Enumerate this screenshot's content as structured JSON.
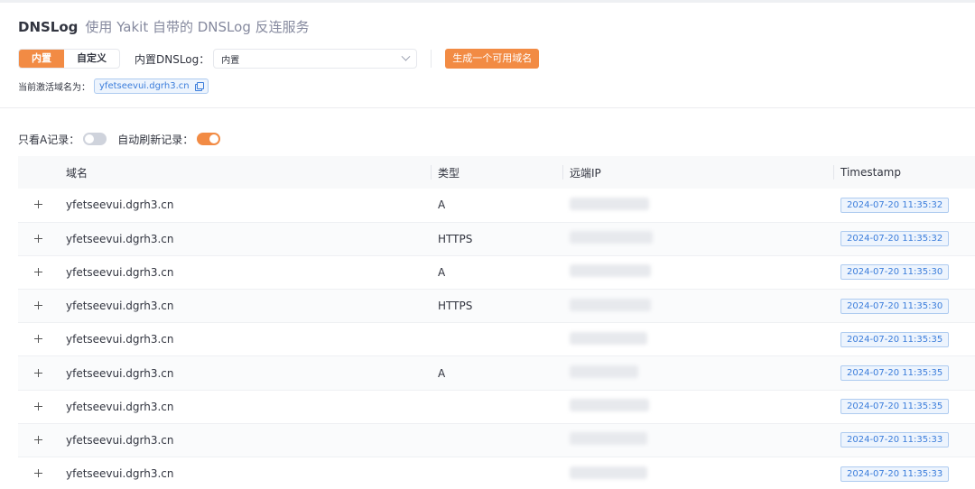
{
  "header": {
    "title": "DNSLog",
    "subtitle": "使用 Yakit 自带的 DNSLog 反连服务",
    "mode_tabs": [
      {
        "label": "内置",
        "active": true
      },
      {
        "label": "自定义",
        "active": false
      }
    ],
    "select_label": "内置DNSLog：",
    "select_value": "内置",
    "generate_button": "生成一个可用域名",
    "current_domain_label": "当前激活域名为：",
    "current_domain": "yfetseevui.dgrh3.cn"
  },
  "filters": {
    "a_only_label": "只看A记录：",
    "a_only_on": false,
    "auto_refresh_label": "自动刷新记录：",
    "auto_refresh_on": true
  },
  "table": {
    "columns": [
      "域名",
      "类型",
      "远端IP",
      "Timestamp"
    ],
    "rows": [
      {
        "domain": "yfetseevui.dgrh3.cn",
        "type": "A",
        "timestamp": "2024-07-20 11:35:32"
      },
      {
        "domain": "yfetseevui.dgrh3.cn",
        "type": "HTTPS",
        "timestamp": "2024-07-20 11:35:32"
      },
      {
        "domain": "yfetseevui.dgrh3.cn",
        "type": "A",
        "timestamp": "2024-07-20 11:35:30"
      },
      {
        "domain": "yfetseevui.dgrh3.cn",
        "type": "HTTPS",
        "timestamp": "2024-07-20 11:35:30"
      },
      {
        "domain": "yfetseevui.dgrh3.cn",
        "type": "",
        "timestamp": "2024-07-20 11:35:35"
      },
      {
        "domain": "yfetseevui.dgrh3.cn",
        "type": "A",
        "timestamp": "2024-07-20 11:35:35"
      },
      {
        "domain": "yfetseevui.dgrh3.cn",
        "type": "",
        "timestamp": "2024-07-20 11:35:35"
      },
      {
        "domain": "yfetseevui.dgrh3.cn",
        "type": "",
        "timestamp": "2024-07-20 11:35:33"
      },
      {
        "domain": "yfetseevui.dgrh3.cn",
        "type": "",
        "timestamp": "2024-07-20 11:35:33"
      }
    ]
  },
  "colors": {
    "accent": "#f28b44",
    "tag_blue": "#3b7ddb"
  }
}
